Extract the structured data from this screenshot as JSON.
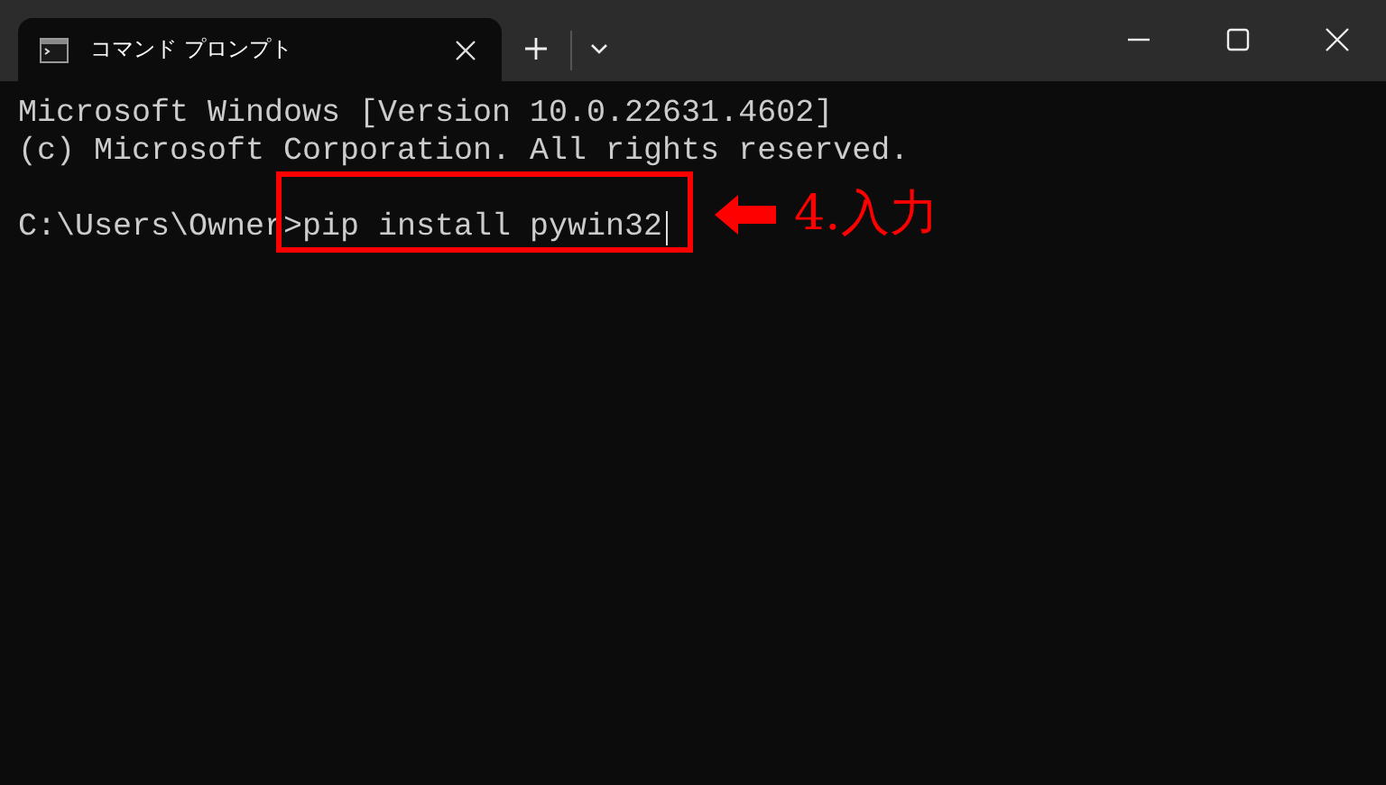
{
  "tabs": [
    {
      "title": "コマンド プロンプト",
      "selected": true
    }
  ],
  "console": {
    "lines": [
      "Microsoft Windows [Version 10.0.22631.4602]",
      "(c) Microsoft Corporation. All rights reserved."
    ],
    "prompt": "C:\\Users\\Owner>",
    "command": "pip install pywin32"
  },
  "annotation": {
    "label": "4.入力"
  }
}
